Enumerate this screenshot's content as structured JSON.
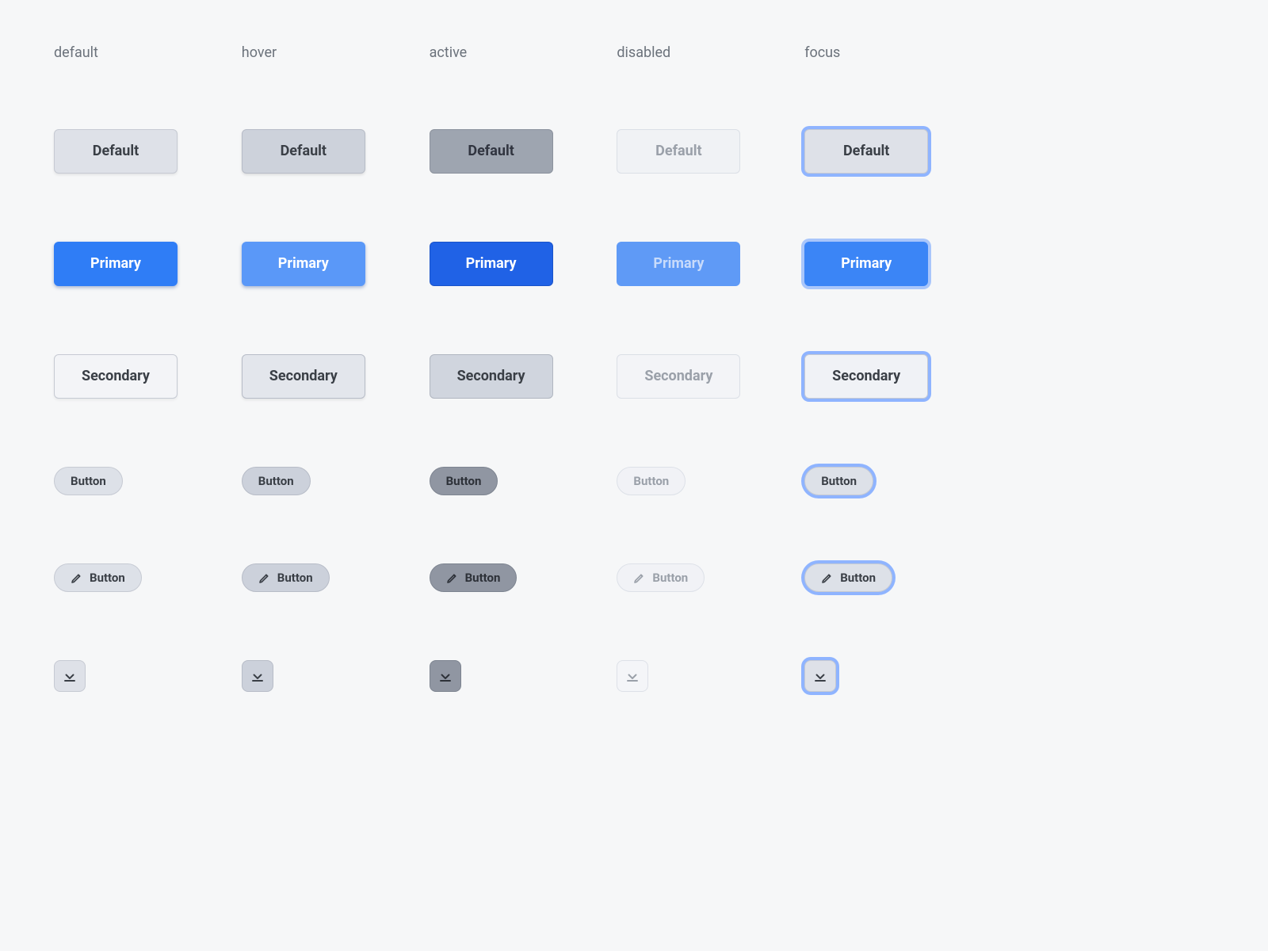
{
  "columns": {
    "default": "default",
    "hover": "hover",
    "active": "active",
    "disabled": "disabled",
    "focus": "focus"
  },
  "rows": {
    "default_variant": {
      "label": "Default"
    },
    "primary_variant": {
      "label": "Primary"
    },
    "secondary_variant": {
      "label": "Secondary"
    },
    "pill": {
      "label": "Button"
    },
    "pill_icon": {
      "label": "Button",
      "icon": "pencil-icon"
    },
    "icon_only": {
      "icon": "download-to-line-icon"
    }
  },
  "colors": {
    "primary": "#2f7df6",
    "focus_ring": "#8fb4ff",
    "neutral_bg": "#dee1e8",
    "neutral_active": "#9ea5b0",
    "text": "#3a3f46",
    "text_disabled": "#9aa0a9"
  }
}
